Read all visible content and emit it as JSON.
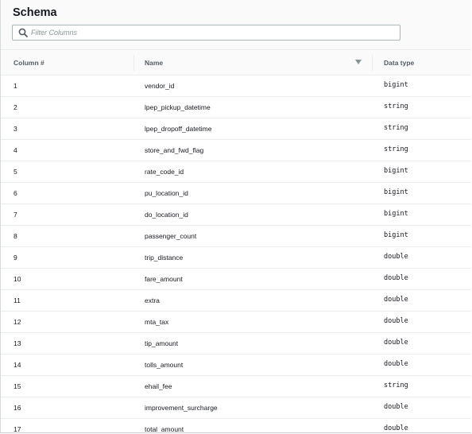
{
  "schema": {
    "title": "Schema",
    "filter": {
      "placeholder": "Filter Columns",
      "value": ""
    },
    "columns": {
      "number": "Column #",
      "name": "Name",
      "type": "Data type"
    },
    "rows": [
      {
        "num": "1",
        "name": "vendor_id",
        "type": "bigint"
      },
      {
        "num": "2",
        "name": "lpep_pickup_datetime",
        "type": "string"
      },
      {
        "num": "3",
        "name": "lpep_dropoff_datetime",
        "type": "string"
      },
      {
        "num": "4",
        "name": "store_and_fwd_flag",
        "type": "string"
      },
      {
        "num": "5",
        "name": "rate_code_id",
        "type": "bigint"
      },
      {
        "num": "6",
        "name": "pu_location_id",
        "type": "bigint"
      },
      {
        "num": "7",
        "name": "do_location_id",
        "type": "bigint"
      },
      {
        "num": "8",
        "name": "passenger_count",
        "type": "bigint"
      },
      {
        "num": "9",
        "name": "trip_distance",
        "type": "double"
      },
      {
        "num": "10",
        "name": "fare_amount",
        "type": "double"
      },
      {
        "num": "11",
        "name": "extra",
        "type": "double"
      },
      {
        "num": "12",
        "name": "mta_tax",
        "type": "double"
      },
      {
        "num": "13",
        "name": "tip_amount",
        "type": "double"
      },
      {
        "num": "14",
        "name": "tolls_amount",
        "type": "double"
      },
      {
        "num": "15",
        "name": "ehail_fee",
        "type": "string"
      },
      {
        "num": "16",
        "name": "improvement_surcharge",
        "type": "double"
      },
      {
        "num": "17",
        "name": "total_amount",
        "type": "double"
      }
    ]
  }
}
